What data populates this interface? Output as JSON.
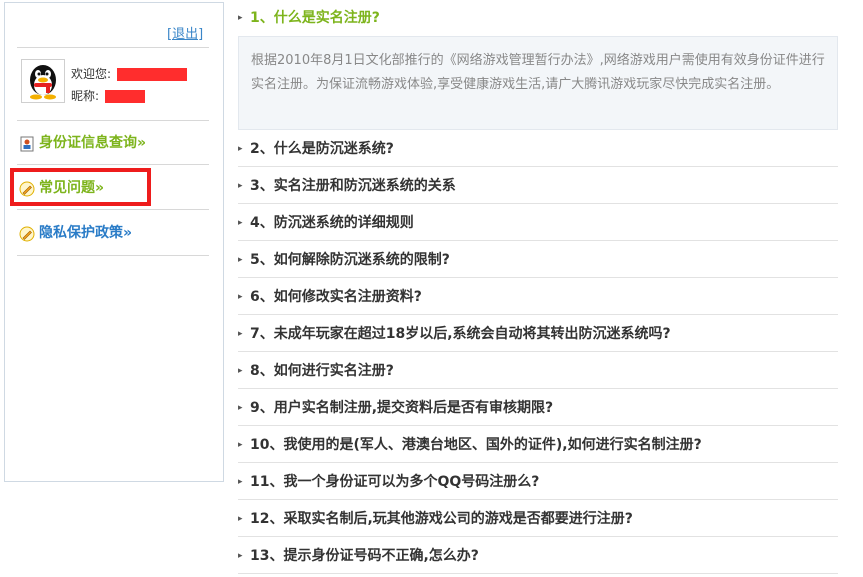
{
  "sidebar": {
    "logout_label": "[退出]",
    "welcome_label": "欢迎您:",
    "nickname_label": "昵称:",
    "nav": [
      {
        "label": "身份证信息查询»",
        "icon": "id-card-icon",
        "color": "#7db41c"
      },
      {
        "label": "常见问题»",
        "icon": "pencil-icon",
        "color": "#7db41c"
      },
      {
        "label": "隐私保护政策»",
        "icon": "pencil-icon",
        "color": "#2a7cc7"
      }
    ],
    "highlight_color": "#ee1c1c",
    "redaction_color": "#ff2d2d"
  },
  "faq": {
    "active_color": "#7db41c",
    "items": [
      {
        "label": "1、什么是实名注册?",
        "expanded": true
      },
      {
        "label": "2、什么是防沉迷系统?"
      },
      {
        "label": "3、实名注册和防沉迷系统的关系"
      },
      {
        "label": "4、防沉迷系统的详细规则"
      },
      {
        "label": "5、如何解除防沉迷系统的限制?"
      },
      {
        "label": "6、如何修改实名注册资料?"
      },
      {
        "label": "7、未成年玩家在超过18岁以后,系统会自动将其转出防沉迷系统吗?"
      },
      {
        "label": "8、如何进行实名注册?"
      },
      {
        "label": "9、用户实名制注册,提交资料后是否有审核期限?"
      },
      {
        "label": "10、我使用的是(军人、港澳台地区、国外的证件),如何进行实名制注册?"
      },
      {
        "label": "11、我一个身份证可以为多个QQ号码注册么?"
      },
      {
        "label": "12、采取实名制后,玩其他游戏公司的游戏是否都要进行注册?"
      },
      {
        "label": "13、提示身份证号码不正确,怎么办?"
      }
    ],
    "answer_text": "根据2010年8月1日文化部推行的《网络游戏管理暂行办法》,网络游戏用户需使用有效身份证件进行实名注册。为保证流畅游戏体验,享受健康游戏生活,请广大腾讯游戏玩家尽快完成实名注册。"
  }
}
